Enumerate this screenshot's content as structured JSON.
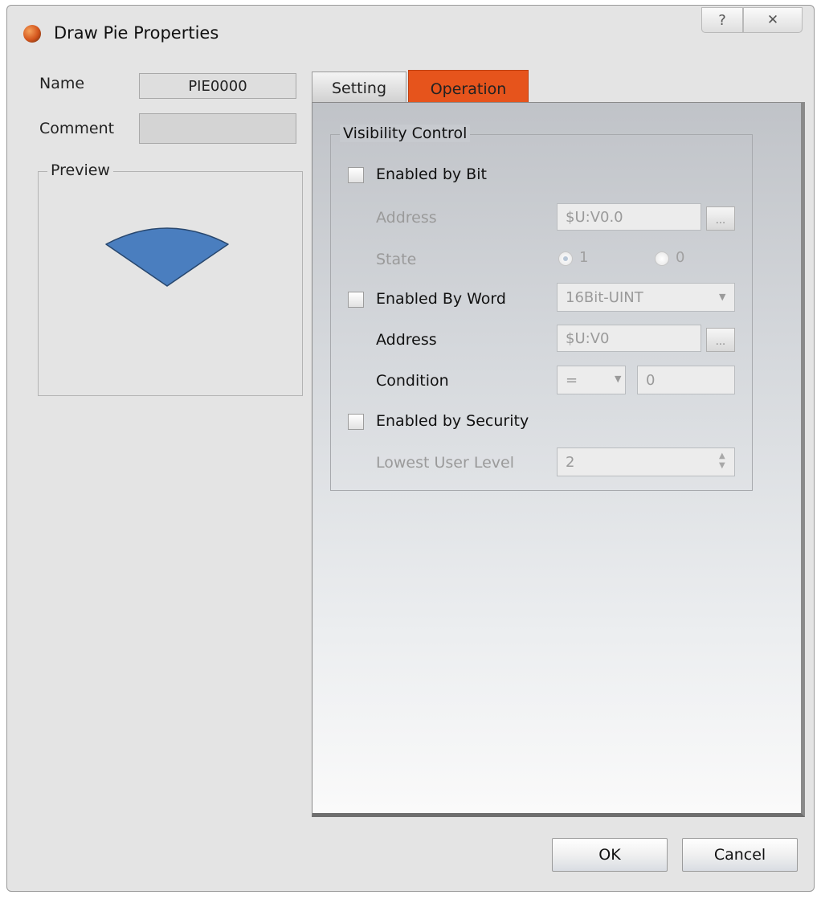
{
  "window": {
    "title": "Draw Pie Properties",
    "help_glyph": "?",
    "close_glyph": "✕"
  },
  "left": {
    "name_label": "Name",
    "name_value": "PIE0000",
    "comment_label": "Comment",
    "comment_value": "",
    "preview_label": "Preview",
    "preview_fill": "#4a7ebf",
    "preview_stroke": "#28476e"
  },
  "tabs": [
    {
      "label": "Setting",
      "active": false
    },
    {
      "label": "Operation",
      "active": true
    }
  ],
  "colors": {
    "active_tab": "#e6541c"
  },
  "visibility": {
    "group_label": "Visibility Control",
    "enabled_by_bit": {
      "label": "Enabled by Bit",
      "checked": false,
      "address_label": "Address",
      "address_value": "$U:V0.0",
      "browse_label": "...",
      "state_label": "State",
      "state_options": [
        "1",
        "0"
      ],
      "state_selected": "1"
    },
    "enabled_by_word": {
      "label": "Enabled By Word",
      "checked": false,
      "type_value": "16Bit-UINT",
      "address_label": "Address",
      "address_value": "$U:V0",
      "browse_label": "...",
      "condition_label": "Condition",
      "condition_operator": "=",
      "condition_value": "0"
    },
    "enabled_by_security": {
      "label": "Enabled by Security",
      "checked": false,
      "level_label": "Lowest User Level",
      "level_value": "2"
    }
  },
  "footer": {
    "ok_label": "OK",
    "cancel_label": "Cancel"
  }
}
